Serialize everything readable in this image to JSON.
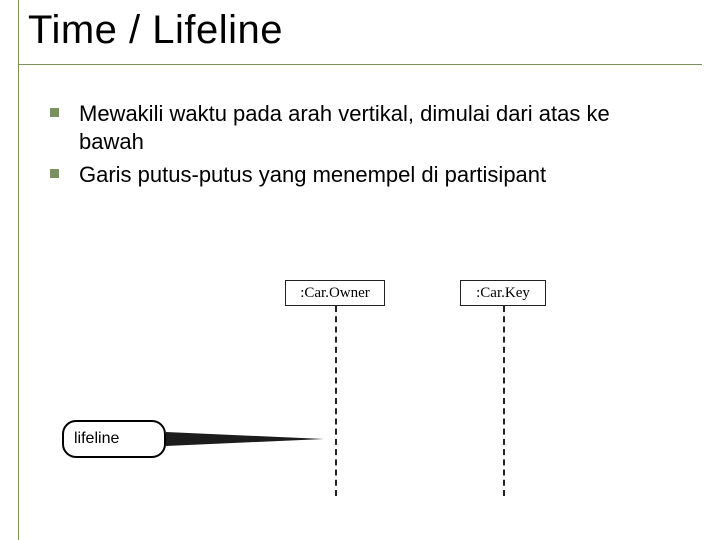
{
  "title": "Time / Lifeline",
  "bullets": [
    "Mewakili waktu pada arah vertikal, dimulai dari atas ke bawah",
    "Garis putus-putus yang menempel di partisipant"
  ],
  "diagram": {
    "participants": [
      ":Car.Owner",
      ":Car.Key"
    ],
    "callout_label": "lifeline"
  }
}
